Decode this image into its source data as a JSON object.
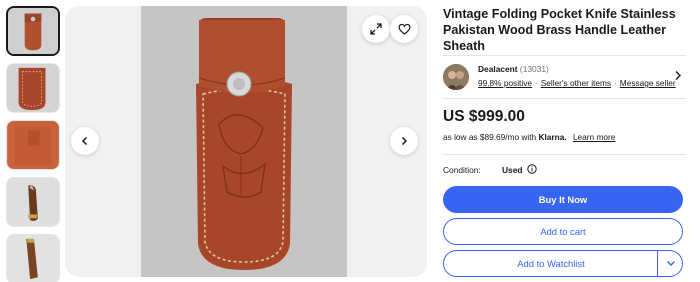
{
  "listing": {
    "title": "Vintage Folding Pocket Knife Stainless Pakistan Wood Brass Handle Leather Sheath"
  },
  "gallery": {
    "thumbnails": [
      "thumbnail-sheath-front",
      "thumbnail-sheath-closeup",
      "thumbnail-sheath-back",
      "thumbnail-knife-closed",
      "thumbnail-knife-handle"
    ],
    "active_index": 0,
    "icons": {
      "expand": "expand-icon",
      "favorite": "heart-icon",
      "prev": "chevron-left-icon",
      "next": "chevron-right-icon"
    }
  },
  "seller": {
    "name": "Dealacent",
    "feedback_count": "(13031)",
    "positive": "99.8% positive",
    "other_items": "Seller's other items",
    "message": "Message seller"
  },
  "pricing": {
    "price": "US $999.00",
    "financing_prefix": "as low as $89.69/mo with",
    "financing_brand": "Klarna.",
    "learn_more": "Learn more"
  },
  "condition": {
    "label": "Condition:",
    "value": "Used"
  },
  "actions": {
    "buy_now": "Buy It Now",
    "add_to_cart": "Add to cart",
    "add_to_watchlist": "Add to Watchlist"
  },
  "colors": {
    "primary": "#3665f3",
    "leather": "#a8492e",
    "text": "#191919"
  }
}
